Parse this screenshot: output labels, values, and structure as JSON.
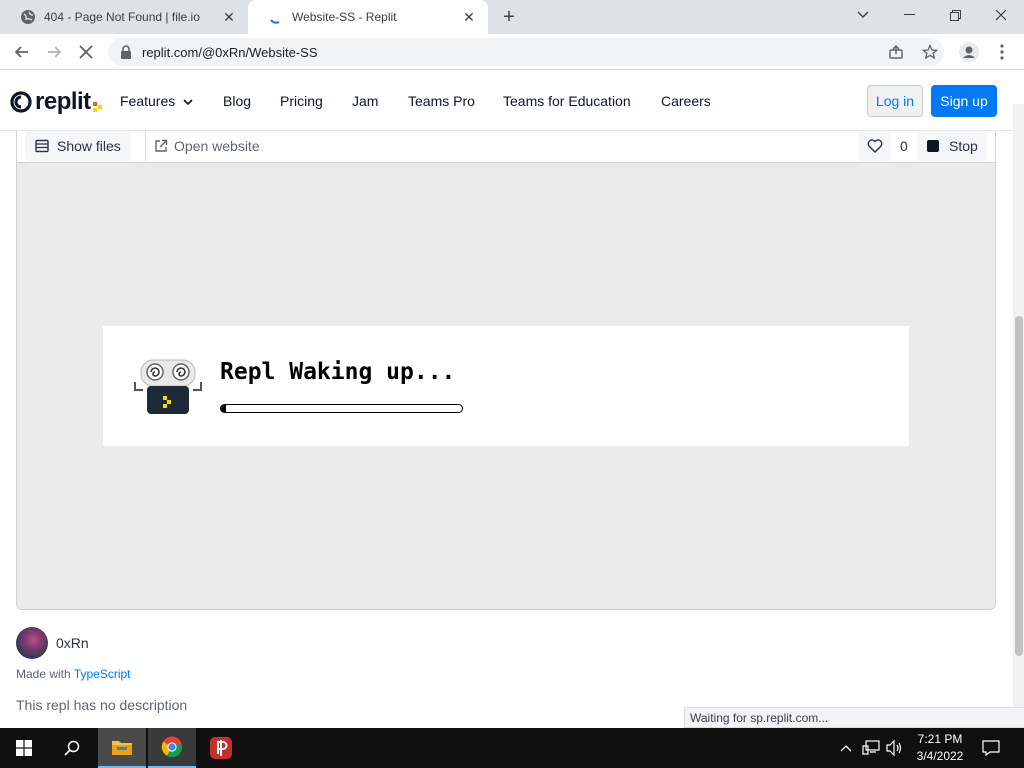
{
  "browser": {
    "tabs": [
      {
        "title": "404 - Page Not Found | file.io",
        "active": false
      },
      {
        "title": "Website-SS - Replit",
        "active": true
      }
    ],
    "url_host": "replit.com",
    "url_path": "/@0xRn/Website-SS",
    "status_text": "Waiting for sp.replit.com..."
  },
  "header": {
    "logo_text": "replit",
    "nav": [
      "Features",
      "Blog",
      "Pricing",
      "Jam",
      "Teams Pro",
      "Teams for Education",
      "Careers"
    ],
    "login_label": "Log in",
    "signup_label": "Sign up"
  },
  "repl_toolbar": {
    "show_files_label": "Show files",
    "open_website_label": "Open website",
    "like_count": "0",
    "stop_label": "Stop"
  },
  "preview": {
    "waking_text": "Repl Waking up...",
    "progress": 0.01
  },
  "repl_info": {
    "author": "0xRn",
    "made_with_prefix": "Made with",
    "language": "TypeScript",
    "description": "This repl has no description"
  },
  "taskbar": {
    "time": "7:21 PM",
    "date": "3/4/2022"
  },
  "colors": {
    "accent": "#0079f2",
    "logo_orange": "#f26207",
    "logo_yellow": "#f5d90a"
  }
}
